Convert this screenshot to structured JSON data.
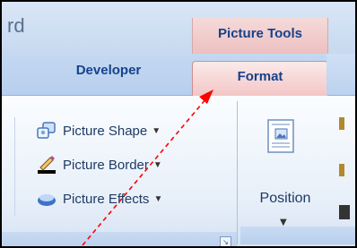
{
  "window": {
    "title_fragment": "rd"
  },
  "context": {
    "label": "Picture Tools"
  },
  "tabs": [
    {
      "label": "Developer",
      "active": false
    },
    {
      "label": "Format",
      "active": true
    }
  ],
  "groups": {
    "picture_styles": {
      "commands": [
        {
          "label": "Picture Shape",
          "icon": "picture-shape-icon"
        },
        {
          "label": "Picture Border",
          "icon": "picture-border-icon"
        },
        {
          "label": "Picture Effects",
          "icon": "picture-effects-icon"
        }
      ],
      "launcher_icon": "dialog-launcher-icon"
    },
    "arrange": {
      "position_label": "Position"
    }
  },
  "colors": {
    "context_tab": "#f3c6c6",
    "annotation": "#ff0000",
    "tab_text": "#15428b"
  }
}
